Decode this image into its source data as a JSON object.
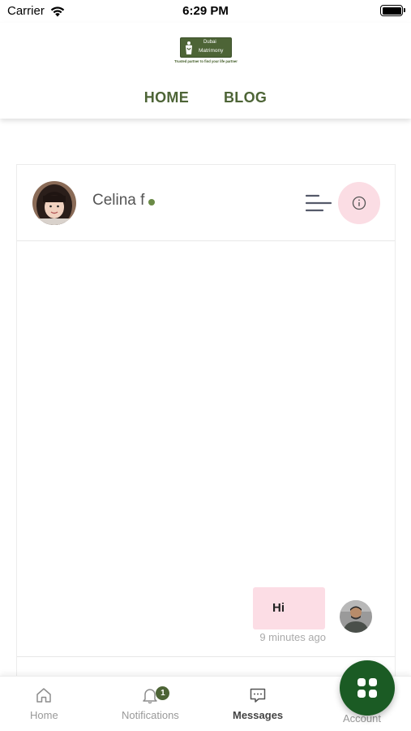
{
  "status_bar": {
    "carrier": "Carrier",
    "time": "6:29 PM"
  },
  "header": {
    "logo_line1": "Dubai",
    "logo_line2": "Matrimony",
    "logo_tagline": "Trusted partner to find your life partner",
    "nav": [
      "HOME",
      "BLOG"
    ]
  },
  "chat": {
    "contact_name": "Celina f",
    "online": true,
    "messages": [
      {
        "text": "Hi",
        "time": "9 minutes ago",
        "sender": "me"
      }
    ]
  },
  "tabs": [
    {
      "label": "Home",
      "icon": "home-icon",
      "active": false
    },
    {
      "label": "Notifications",
      "icon": "bell-icon",
      "badge": "1",
      "active": false
    },
    {
      "label": "Messages",
      "icon": "message-icon",
      "active": true
    },
    {
      "label": "Account",
      "icon": "grid-icon",
      "active": false
    }
  ],
  "colors": {
    "brand_green": "#4d6436",
    "fab_green": "#1b5b24",
    "bubble_pink": "#fcdde5",
    "info_pink": "#fbdde4",
    "online_dot": "#6a8a46"
  }
}
